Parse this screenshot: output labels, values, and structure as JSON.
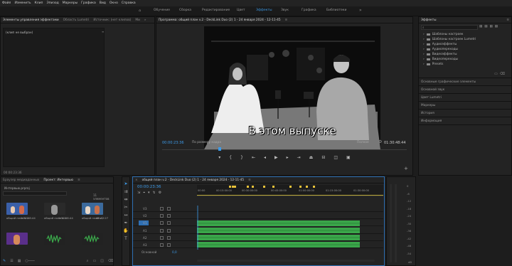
{
  "menu": [
    "Файл",
    "Изменить",
    "Клип",
    "Эпизод",
    "Маркеры",
    "Графика",
    "Вид",
    "Окно",
    "Справка"
  ],
  "workspaces": [
    "Обучение",
    "Сборка",
    "Редактирование",
    "Цвет",
    "Эффекты",
    "Звук",
    "Графика",
    "Библиотеки"
  ],
  "active_workspace": "Эффекты",
  "effect_controls": {
    "tabs": [
      "Элементы управления эффектами",
      "Область Lumetri",
      "Источник: (нет клипов)",
      "Ми"
    ],
    "no_clip": "(клип не выбран)",
    "timecode": "00:00:23:36"
  },
  "program": {
    "title": "Программа: общий план v.2 - DeckLink Duo (2) 1 - 24 января 2024 - 12-11-45",
    "caption": "В этом выпуске",
    "timecode": "00:00:23:36",
    "fit": "По размеру кадра",
    "quality": "Полное",
    "duration": "01:30:48:44"
  },
  "effects_panel": {
    "title": "Эффекты",
    "search_placeholder": "",
    "folders": [
      "Шаблоны настроек",
      "Шаблоны настроек Lumetri",
      "Аудиоэффекты",
      "Аудиопереходы",
      "Видеоэффекты",
      "Видеопереходы",
      "Presets"
    ],
    "sections": [
      "Основные графические элементы",
      "Основной звук",
      "Цвет Lumetri",
      "Маркеры",
      "История",
      "Информация"
    ]
  },
  "project": {
    "tabs": [
      "Браузер медиаданных",
      "Проект: Интервью"
    ],
    "file": "Интервью.prproj",
    "count": "11 элементов",
    "items": [
      {
        "name": "общий план v.2",
        "duration": "1:30:48:44"
      },
      {
        "name": "общий план v.2",
        "duration": "1:30:48:44"
      },
      {
        "name": "общий план v.2",
        "duration": "45:42:27"
      },
      {
        "name": "",
        "duration": ""
      },
      {
        "name": "",
        "duration": ""
      },
      {
        "name": "",
        "duration": ""
      }
    ]
  },
  "timeline": {
    "title": "общий план v.2 - DeckLink Duo (2) 1 - 24 января 2024 - 12-11-45",
    "timecode": "00:00:23:36",
    "ruler": [
      "00:00",
      "00:15:00:00",
      "00:30:00:00",
      "00:45:00:00",
      "01:00:00:00",
      "01:15:00:00",
      "01:30:00:00"
    ],
    "video_tracks": [
      "V3",
      "V2",
      "V1"
    ],
    "audio_tracks": [
      "A1",
      "A2",
      "A3"
    ],
    "master": "Основной",
    "master_value": "0,0"
  },
  "meter_ticks": [
    "0",
    "-6",
    "-12",
    "-18",
    "-24",
    "-30",
    "-36",
    "-42",
    "-48",
    "-54"
  ],
  "meter_footer": "dB",
  "colors": {
    "accent": "#3d9be9",
    "audio_clip": "#3aa64a",
    "video_clip": "#7d6cc4",
    "marker": "#e8c23a"
  }
}
